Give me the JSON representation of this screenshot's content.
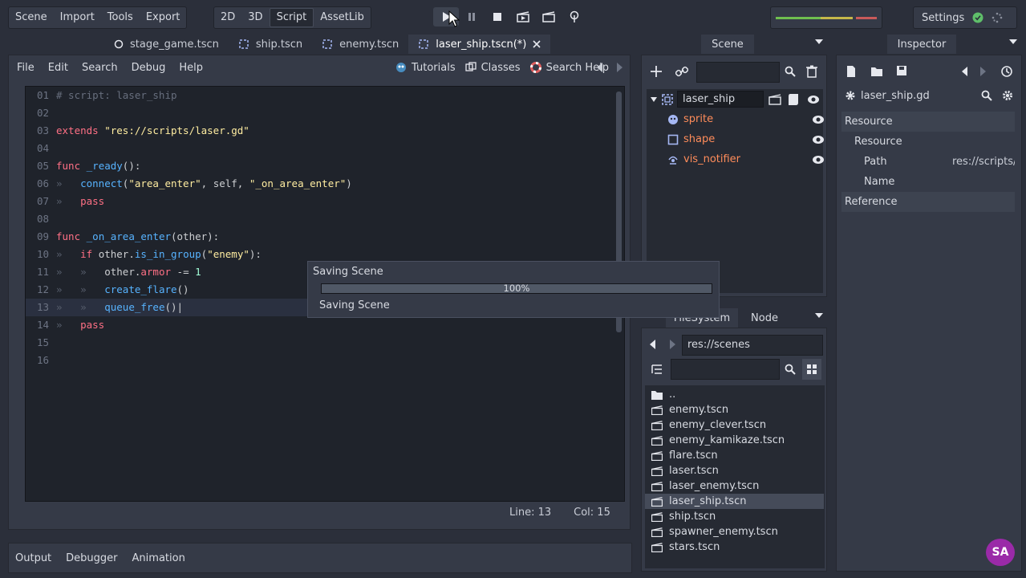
{
  "menu": {
    "items": [
      "Scene",
      "Import",
      "Tools",
      "Export"
    ]
  },
  "workspace": {
    "items": [
      "2D",
      "3D",
      "Script",
      "AssetLib"
    ],
    "active": "Script"
  },
  "settings": {
    "label": "Settings"
  },
  "tabs": [
    {
      "label": "stage_game.tscn",
      "icon": "circle-node-icon"
    },
    {
      "label": "ship.tscn",
      "icon": "area2d-icon"
    },
    {
      "label": "enemy.tscn",
      "icon": "area2d-icon"
    },
    {
      "label": "laser_ship.tscn(*)",
      "icon": "area2d-icon",
      "active": true
    }
  ],
  "editor": {
    "menus": [
      "File",
      "Edit",
      "Search",
      "Debug",
      "Help"
    ],
    "tools": {
      "tutorials": "Tutorials",
      "classes": "Classes",
      "search_help": "Search Help"
    },
    "status": {
      "line": "Line: 13",
      "col": "Col: 15"
    },
    "lines": [
      {
        "n": "01",
        "html": "<span class='cm'># script: laser_ship</span>"
      },
      {
        "n": "02",
        "html": ""
      },
      {
        "n": "03",
        "html": "<span class='kw'>extends</span> <span class='str'>\"res://scripts/laser.gd\"</span>"
      },
      {
        "n": "04",
        "html": ""
      },
      {
        "n": "05",
        "html": "<span class='kw'>func</span> <span class='fn'>_ready</span><span class='pl'>():</span>"
      },
      {
        "n": "06",
        "html": "<span class='ws'>»   </span><span class='fn'>connect</span><span class='pl'>(</span><span class='str'>\"area_enter\"</span><span class='pl'>, self, </span><span class='str'>\"_on_area_enter\"</span><span class='pl'>)</span>"
      },
      {
        "n": "07",
        "html": "<span class='ws'>»   </span><span class='kw'>pass</span>"
      },
      {
        "n": "08",
        "html": ""
      },
      {
        "n": "09",
        "html": "<span class='kw'>func</span> <span class='fn'>_on_area_enter</span><span class='pl'>(other):</span>"
      },
      {
        "n": "10",
        "html": "<span class='ws'>»   </span><span class='kw'>if</span> <span class='pl'>other.</span><span class='fn'>is_in_group</span><span class='pl'>(</span><span class='str'>\"enemy\"</span><span class='pl'>):</span>"
      },
      {
        "n": "11",
        "html": "<span class='ws'>»   »   </span><span class='pl'>other.</span><span class='kw'>armor</span><span class='pl'> -= </span><span class='num'>1</span>"
      },
      {
        "n": "12",
        "html": "<span class='ws'>»   »   </span><span class='fn'>create_flare</span><span class='pl'>()</span>"
      },
      {
        "n": "13",
        "html": "<span class='ws'>»   »   </span><span class='fn'>queue_free</span><span class='pl'>()|</span>"
      },
      {
        "n": "14",
        "html": "<span class='ws'>»   </span><span class='kw'>pass</span>"
      },
      {
        "n": "15",
        "html": ""
      },
      {
        "n": "16",
        "html": ""
      }
    ]
  },
  "scene": {
    "tab": "Scene",
    "root": "laser_ship",
    "children": [
      {
        "name": "sprite",
        "icon": "sprite-icon"
      },
      {
        "name": "shape",
        "icon": "shape-icon"
      },
      {
        "name": "vis_notifier",
        "icon": "visibility-notifier-icon"
      }
    ]
  },
  "filesystem": {
    "tabs": [
      "FileSystem",
      "Node"
    ],
    "path": "res://scenes",
    "files": [
      "..",
      "enemy.tscn",
      "enemy_clever.tscn",
      "enemy_kamikaze.tscn",
      "flare.tscn",
      "laser.tscn",
      "laser_enemy.tscn",
      "laser_ship.tscn",
      "ship.tscn",
      "spawner_enemy.tscn",
      "stars.tscn"
    ],
    "selected": "laser_ship.tscn"
  },
  "inspector": {
    "tab": "Inspector",
    "object": "laser_ship.gd",
    "sections": {
      "resource": "Resource",
      "resource_sub": "Resource",
      "path_label": "Path",
      "path_value": "res://scripts/",
      "name_label": "Name",
      "reference": "Reference"
    }
  },
  "dialog": {
    "title": "Saving Scene",
    "progress_label": "100%",
    "progress": 1.0,
    "status": "Saving Scene"
  },
  "bottom": {
    "tabs": [
      "Output",
      "Debugger",
      "Animation"
    ]
  },
  "colors": {
    "bg": "#2b2f3a",
    "panel": "#353a47",
    "code_bg": "#1f232b",
    "node_orange": "#ff8c5a",
    "keyword": "#ff7085",
    "string": "#ffeda1"
  }
}
